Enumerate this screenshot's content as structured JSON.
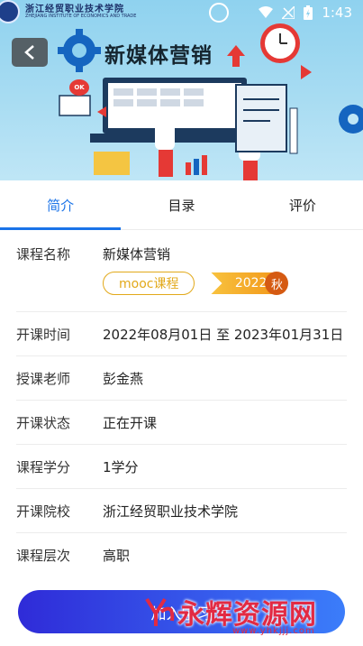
{
  "status": {
    "time": "1:43"
  },
  "banner": {
    "logo_cn": "浙江经贸职业技术学院",
    "logo_en": "ZHEJIANG INSTITUTE OF ECONOMICS AND TRADE",
    "title": "新媒体营销",
    "ok_text": "OK"
  },
  "tabs": [
    {
      "label": "简介",
      "active": true
    },
    {
      "label": "目录",
      "active": false
    },
    {
      "label": "评价",
      "active": false
    }
  ],
  "info": {
    "course_name": {
      "label": "课程名称",
      "value": "新媒体营销"
    },
    "tags": {
      "mooc": "mooc课程",
      "year": "2022",
      "season": "秋"
    },
    "rows": [
      {
        "label": "开课时间",
        "value": "2022年08月01日 至 2023年01月31日"
      },
      {
        "label": "授课老师",
        "value": "彭金燕"
      },
      {
        "label": "开课状态",
        "value": "正在开课"
      },
      {
        "label": "课程学分",
        "value": "1学分"
      },
      {
        "label": "开课院校",
        "value": "浙江经贸职业技术学院"
      },
      {
        "label": "课程层次",
        "value": "高职"
      }
    ]
  },
  "bottom": {
    "button_label": "加入学习"
  },
  "watermark": {
    "text": "永辉资源网",
    "url": "www.yhkjjj.com"
  },
  "colors": {
    "accent": "#1a73e8",
    "tag": "#e2a91a",
    "button_start": "#2f2bd8",
    "button_end": "#3b7dfa"
  }
}
